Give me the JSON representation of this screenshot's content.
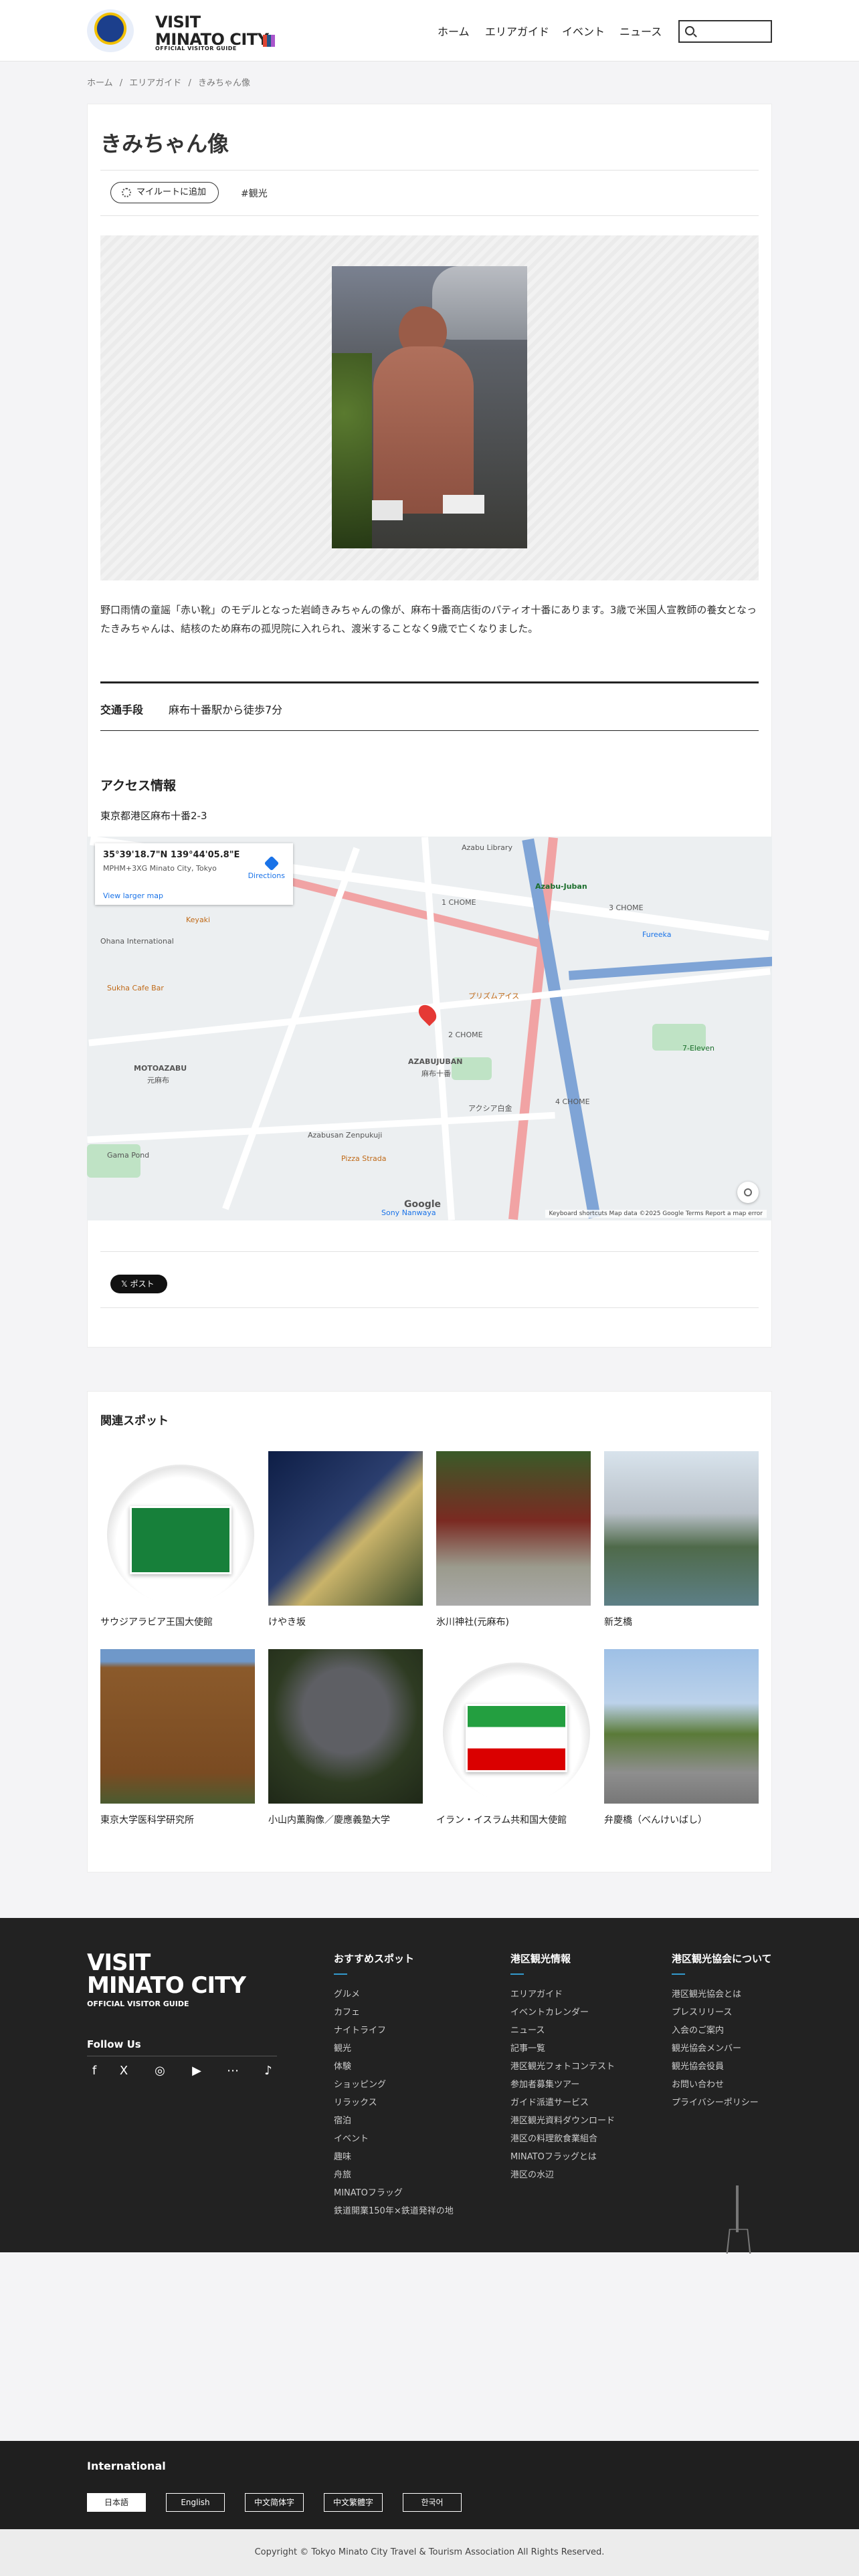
{
  "header": {
    "logo_line1": "VISIT",
    "logo_line2": "MINATO CITY",
    "logo_sub": "OFFICIAL VISITOR GUIDE",
    "nav": [
      "ホーム",
      "エリアガイド",
      "イベント",
      "ニュース"
    ],
    "search_placeholder": ""
  },
  "breadcrumb": [
    "ホーム",
    "エリアガイド",
    "きみちゃん像"
  ],
  "article": {
    "title": "きみちゃん像",
    "route_button": "マイルートに追加",
    "tag": "#観光",
    "description": "野口雨情の童謡「赤い靴」のモデルとなった岩崎きみちゃんの像が、麻布十番商店街のパティオ十番にあります。3歳で米国人宣教師の養女となったきみちゃんは、結核のため麻布の孤児院に入れられ、渡米することなく9歳で亡くなりました。",
    "access_label": "交通手段",
    "access_value": "麻布十番駅から徒歩7分",
    "access_heading": "アクセス情報",
    "address": "東京都港区麻布十番2-3"
  },
  "map": {
    "coord": "35°39'18.7\"N 139°44'05.8\"E",
    "plus_code": "MPHM+3XG Minato City, Tokyo",
    "larger": "View larger map",
    "directions": "Directions",
    "footer": "Keyboard shortcuts   Map data ©2025 Google   Terms   Report a map error",
    "google": "Google",
    "labels": [
      "Azabu Library",
      "1 CHOME",
      "Azabu-Juban",
      "Keyaki",
      "Ohana International",
      "Sukha Cafe Bar",
      "MOTOAZABU",
      "元麻布",
      "AZABUJUBAN",
      "麻布十番",
      "2 CHOME",
      "3 CHOME",
      "4 CHOME",
      "Azabusan Zenpukuji",
      "Pizza Strada",
      "Gama Pond",
      "Sony Nanwaya",
      "7-Eleven",
      "Fureeka",
      "プリズムアイス",
      "アクシア白金"
    ]
  },
  "share": {
    "post": "ポスト"
  },
  "related": {
    "title": "関連スポット",
    "items": [
      {
        "name": "サウジアラビア王国大使館"
      },
      {
        "name": "けやき坂"
      },
      {
        "name": "氷川神社(元麻布)"
      },
      {
        "name": "新芝橋"
      },
      {
        "name": "東京大学医科学研究所"
      },
      {
        "name": "小山内薫胸像／慶應義塾大学"
      },
      {
        "name": "イラン・イスラム共和国大使館"
      },
      {
        "name": "弁慶橋（べんけいばし）"
      }
    ]
  },
  "footer": {
    "logo_line1": "VISIT",
    "logo_line2": "MINATO CITY",
    "logo_sub": "OFFICIAL VISITOR GUIDE",
    "follow": "Follow Us",
    "social": [
      "f",
      "X",
      "◎",
      "▶",
      "⋯",
      "♪"
    ],
    "col1": {
      "head": "おすすめスポット",
      "items": [
        "グルメ",
        "カフェ",
        "ナイトライフ",
        "観光",
        "体験",
        "ショッピング",
        "リラックス",
        "宿泊",
        "イベント",
        "趣味",
        "舟旅",
        "MINATOフラッグ",
        "鉄道開業150年×鉄道発祥の地"
      ]
    },
    "col2": {
      "head": "港区観光情報",
      "items": [
        "エリアガイド",
        "イベントカレンダー",
        "ニュース",
        "記事一覧",
        "港区観光フォトコンテスト",
        "参加者募集ツアー",
        "ガイド派遣サービス",
        "港区観光資料ダウンロード",
        "港区の料理飲食業組合",
        "MINATOフラッグとは",
        "港区の水辺"
      ]
    },
    "col3": {
      "head": "港区観光協会について",
      "items": [
        "港区観光協会とは",
        "プレスリリース",
        "入会のご案内",
        "観光協会メンバー",
        "観光協会役員",
        "お問い合わせ",
        "プライバシーポリシー"
      ]
    }
  },
  "international": {
    "title": "International",
    "langs": [
      "日本語",
      "English",
      "中文简体字",
      "中文繁體字",
      "한국어"
    ]
  },
  "copyright": "Copyright © Tokyo Minato City Travel & Tourism Association All Rights Reserved."
}
